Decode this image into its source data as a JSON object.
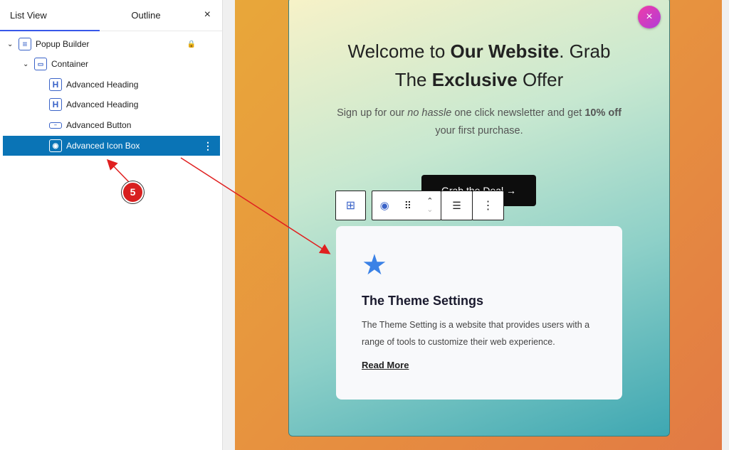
{
  "panel": {
    "tab_list": "List View",
    "tab_outline": "Outline",
    "close": "×",
    "items": [
      {
        "label": "Popup Builder",
        "icon": "page-icon"
      },
      {
        "label": "Container",
        "icon": "container-icon"
      },
      {
        "label": "Advanced Heading",
        "icon": "heading-icon"
      },
      {
        "label": "Advanced Heading",
        "icon": "heading-icon"
      },
      {
        "label": "Advanced Button",
        "icon": "button-icon"
      },
      {
        "label": "Advanced Icon Box",
        "icon": "icon-box-icon"
      }
    ]
  },
  "popup": {
    "heading_a": "Welcome to ",
    "heading_b": "Our Website",
    "heading_c": ". Grab",
    "heading_d": "The ",
    "heading_e": "Exclusive",
    "heading_f": " Offer",
    "sub_a": "Sign up for our ",
    "sub_b": "no hassle",
    "sub_c": " one click newsletter and get ",
    "sub_d": "10% off",
    "sub_e": " your first purchase.",
    "button": "Grab the Deal",
    "close": "×"
  },
  "card": {
    "title": "The Theme Settings",
    "description": "The Theme Setting is a website that provides users with a range of tools to customize their web experience.",
    "link": "Read More"
  },
  "annotation": {
    "step": "5",
    "color": "#d81f1f"
  }
}
